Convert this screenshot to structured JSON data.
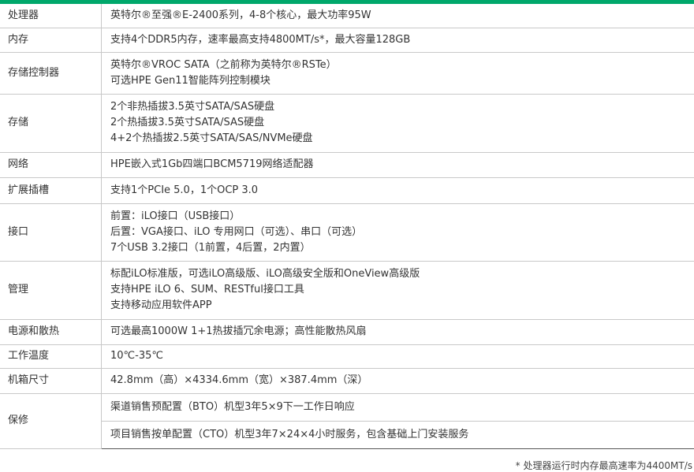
{
  "accent_color": "#00a86b",
  "rows": [
    {
      "label": "处理器",
      "lines": [
        "英特尔®至强®E-2400系列，4-8个核心，最大功率95W"
      ]
    },
    {
      "label": "内存",
      "lines": [
        "支持4个DDR5内存，速率最高支持4800MT/s*，最大容量128GB"
      ]
    },
    {
      "label": "存储控制器",
      "lines": [
        "英特尔®VROC SATA（之前称为英特尔®RSTe）",
        "可选HPE Gen11智能阵列控制模块"
      ]
    },
    {
      "label": "存储",
      "lines": [
        "2个非热插拔3.5英寸SATA/SAS硬盘",
        "2个热插拔3.5英寸SATA/SAS硬盘",
        "4+2个热插拔2.5英寸SATA/SAS/NVMe硬盘"
      ]
    },
    {
      "label": "网络",
      "lines": [
        "HPE嵌入式1Gb四端口BCM5719网络适配器"
      ]
    },
    {
      "label": "扩展插槽",
      "lines": [
        "支持1个PCIe 5.0，1个OCP 3.0"
      ]
    },
    {
      "label": "接口",
      "lines": [
        "前置：iLO接口（USB接口）",
        "后置：VGA接口、iLO 专用网口（可选）、串口（可选）",
        "7个USB 3.2接口（1前置，4后置，2内置）"
      ]
    },
    {
      "label": "管理",
      "lines": [
        "标配iLO标准版，可选iLO高级版、iLO高级安全版和OneView高级版",
        "支持HPE iLO 6、SUM、RESTful接口工具",
        "支持移动应用软件APP"
      ]
    },
    {
      "label": "电源和散热",
      "lines": [
        "可选最高1000W 1+1热拔插冗余电源；高性能散热风扇"
      ]
    },
    {
      "label": "工作温度",
      "lines": [
        "10℃-35℃"
      ]
    },
    {
      "label": "机箱尺寸",
      "lines": [
        "42.8mm（高）×4334.6mm（宽）×387.4mm（深）"
      ]
    }
  ],
  "warranty": {
    "label": "保修",
    "lines": [
      "渠道销售预配置（BTO）机型3年5×9下一工作日响应",
      "项目销售按单配置（CTO）机型3年7×24×4小时服务，包含基础上门安装服务"
    ]
  },
  "footnote": "* 处理器运行时内存最高速率为4400MT/s"
}
